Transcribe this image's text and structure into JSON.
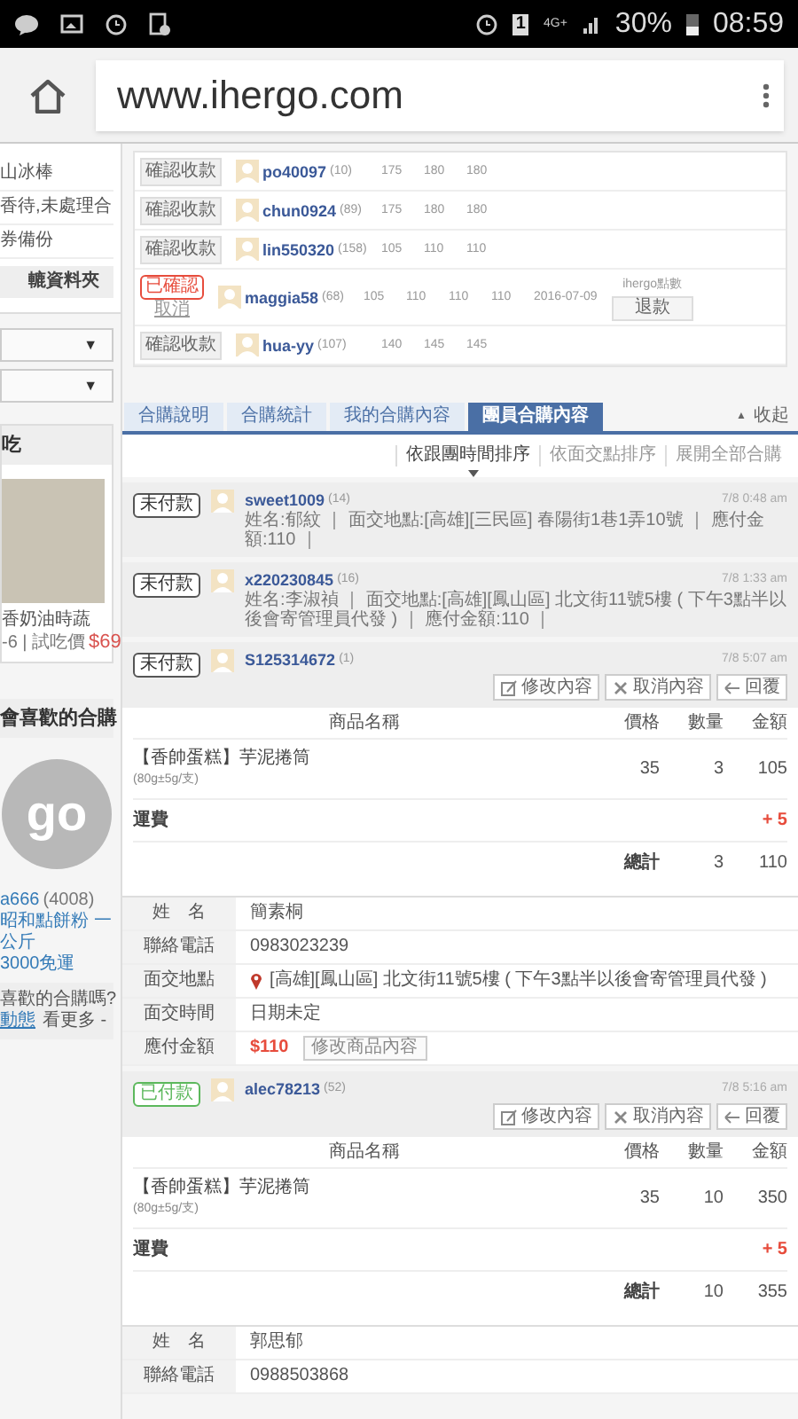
{
  "status_bar": {
    "time": "08:59",
    "battery": "30%",
    "network": "4G+",
    "sim": "1"
  },
  "browser": {
    "url": "www.ihergo.com"
  },
  "sidebar": {
    "lines": [
      "山冰棒",
      "香待,未處理合",
      "券備份"
    ],
    "folder_button": "轆資料夾",
    "dropdowns": [
      {
        "caret": "▼"
      },
      {
        "caret": "▼"
      }
    ],
    "food_section": {
      "title": "吃",
      "product": "香奶油時蔬",
      "meta": "-6 | 試吃價",
      "price": "$69"
    },
    "recommend_section": {
      "title": "會喜歡的合購",
      "logo": "go",
      "user": "a666",
      "user_count": "(4008)",
      "product": "昭和點餅粉 一公斤",
      "shipping": "3000免運"
    },
    "prompt": {
      "question": "喜歡的合購嗎?",
      "link": "動態",
      "more": "看更多 -"
    }
  },
  "payments": [
    {
      "kind": "pending",
      "action": "確認收款",
      "user": "po40097",
      "count": "(10)",
      "values": [
        "175",
        "180",
        "180"
      ]
    },
    {
      "kind": "pending",
      "action": "確認收款",
      "user": "chun0924",
      "count": "(89)",
      "values": [
        "175",
        "180",
        "180"
      ]
    },
    {
      "kind": "pending",
      "action": "確認收款",
      "user": "lin550320",
      "count": "(158)",
      "values": [
        "105",
        "110",
        "110"
      ]
    },
    {
      "kind": "confirmed",
      "action": "已確認",
      "cancel": "取消",
      "user": "maggia58",
      "count": "(68)",
      "values": [
        "105",
        "110",
        "110",
        "110",
        "2016-07-09"
      ],
      "refund_label": "ihergo點數",
      "refund_button": "退款"
    },
    {
      "kind": "pending",
      "action": "確認收款",
      "user": "hua-yy",
      "count": "(107)",
      "values": [
        "140",
        "145",
        "145"
      ]
    }
  ],
  "tabs": [
    {
      "label": "合購說明",
      "selected": false
    },
    {
      "label": "合購統計",
      "selected": false
    },
    {
      "label": "我的合購內容",
      "selected": false
    },
    {
      "label": "團員合購內容",
      "selected": true
    }
  ],
  "collapse": {
    "arrow": "▲",
    "label": "收起"
  },
  "sort_options": [
    {
      "label": "依跟團時間排序",
      "selected": true
    },
    {
      "label": "依面交點排序",
      "selected": false
    },
    {
      "label": "展開全部合購",
      "selected": false
    }
  ],
  "orders": [
    {
      "status": "未付款",
      "paid": false,
      "user": "sweet1009",
      "count": "(14)",
      "time": "7/8 0:48 am",
      "expanded": false,
      "summary": "姓名:郁紋 ｜ 面交地點:[高雄][三民區] 春陽街1巷1弄10號 ｜ 應付金額:110 ｜"
    },
    {
      "status": "未付款",
      "paid": false,
      "user": "x220230845",
      "count": "(16)",
      "time": "7/8 1:33 am",
      "expanded": false,
      "summary": "姓名:李淑禎 ｜ 面交地點:[高雄][鳳山區] 北文街11號5樓 ( 下午3點半以後會寄管理員代發 ) ｜ 應付金額:110 ｜"
    },
    {
      "status": "未付款",
      "paid": false,
      "user": "S125314672",
      "count": "(1)",
      "time": "7/8 5:07 am",
      "expanded": true,
      "actions": [
        "修改內容",
        "取消內容",
        "回覆"
      ],
      "items_header": [
        "商品名稱",
        "價格",
        "數量",
        "金額"
      ],
      "items": [
        {
          "name": "【香帥蛋糕】芋泥捲筒",
          "spec": "(80g±5g/支)",
          "price": "35",
          "qty": "3",
          "amount": "105"
        }
      ],
      "shipping": {
        "label": "運費",
        "amount": "+ 5"
      },
      "total": {
        "label": "總計",
        "qty": "3",
        "amount": "110"
      },
      "info": [
        {
          "kind": "text",
          "label": "姓　名",
          "value": "簡素桐"
        },
        {
          "kind": "text",
          "label": "聯絡電話",
          "value": "0983023239"
        },
        {
          "kind": "location",
          "label": "面交地點",
          "value": "[高雄][鳳山區] 北文街11號5樓 ( 下午3點半以後會寄管理員代發 )"
        },
        {
          "kind": "text",
          "label": "面交時間",
          "value": "日期未定"
        },
        {
          "kind": "amount",
          "label": "應付金額",
          "value": "$110",
          "button": "修改商品內容"
        }
      ]
    },
    {
      "status": "已付款",
      "paid": true,
      "user": "alec78213",
      "count": "(52)",
      "time": "7/8 5:16 am",
      "expanded": true,
      "actions": [
        "修改內容",
        "取消內容",
        "回覆"
      ],
      "items_header": [
        "商品名稱",
        "價格",
        "數量",
        "金額"
      ],
      "items": [
        {
          "name": "【香帥蛋糕】芋泥捲筒",
          "spec": "(80g±5g/支)",
          "price": "35",
          "qty": "10",
          "amount": "350"
        }
      ],
      "shipping": {
        "label": "運費",
        "amount": "+ 5"
      },
      "total": {
        "label": "總計",
        "qty": "10",
        "amount": "355"
      },
      "info": [
        {
          "kind": "text",
          "label": "姓　名",
          "value": "郭思郁"
        },
        {
          "kind": "text",
          "label": "聯絡電話",
          "value": "0988503868"
        }
      ]
    }
  ]
}
